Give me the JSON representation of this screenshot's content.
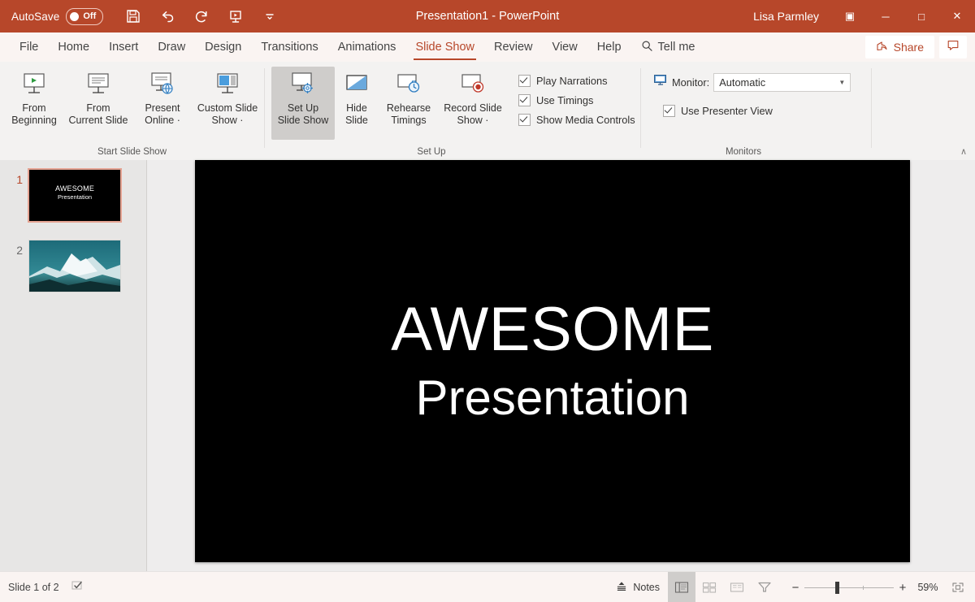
{
  "titlebar": {
    "autosave_label": "AutoSave",
    "autosave_state": "Off",
    "document_title": "Presentation1  -  PowerPoint",
    "user_name": "Lisa Parmley",
    "quick_access": [
      {
        "name": "save-icon",
        "tooltip": "Save"
      },
      {
        "name": "undo-icon",
        "tooltip": "Undo"
      },
      {
        "name": "redo-icon",
        "tooltip": "Redo"
      },
      {
        "name": "start-from-beginning-icon",
        "tooltip": "Start From Beginning"
      },
      {
        "name": "customize-quick-access-toolbar-icon",
        "tooltip": "Customize Quick Access Toolbar"
      }
    ],
    "window_controls": {
      "ribbon_display_options": "▣",
      "minimize": "─",
      "maximize": "□",
      "close": "✕"
    },
    "accent_color": "#b7472a"
  },
  "tabs": [
    {
      "label": "File",
      "active": false
    },
    {
      "label": "Home",
      "active": false
    },
    {
      "label": "Insert",
      "active": false
    },
    {
      "label": "Draw",
      "active": false
    },
    {
      "label": "Design",
      "active": false
    },
    {
      "label": "Transitions",
      "active": false
    },
    {
      "label": "Animations",
      "active": false
    },
    {
      "label": "Slide Show",
      "active": true
    },
    {
      "label": "Review",
      "active": false
    },
    {
      "label": "View",
      "active": false
    },
    {
      "label": "Help",
      "active": false
    }
  ],
  "tellme": {
    "label": "Tell me"
  },
  "share": {
    "label": "Share"
  },
  "ribbon": {
    "groups": [
      {
        "caption": "Start Slide Show",
        "buttons": [
          {
            "line1": "From",
            "line2": "Beginning",
            "icon": "from-beginning-icon",
            "selected": false,
            "dropdown": false
          },
          {
            "line1": "From",
            "line2": "Current Slide",
            "icon": "from-current-slide-icon",
            "selected": false,
            "dropdown": false
          },
          {
            "line1": "Present",
            "line2": "Online",
            "icon": "present-online-icon",
            "selected": false,
            "dropdown": true
          },
          {
            "line1": "Custom Slide",
            "line2": "Show",
            "icon": "custom-slide-show-icon",
            "selected": false,
            "dropdown": true
          }
        ]
      },
      {
        "caption": "Set Up",
        "buttons": [
          {
            "line1": "Set Up",
            "line2": "Slide Show",
            "icon": "set-up-slide-show-icon",
            "selected": true,
            "dropdown": false
          },
          {
            "line1": "Hide",
            "line2": "Slide",
            "icon": "hide-slide-icon",
            "selected": false,
            "dropdown": false
          },
          {
            "line1": "Rehearse",
            "line2": "Timings",
            "icon": "rehearse-timings-icon",
            "selected": false,
            "dropdown": false
          },
          {
            "line1": "Record Slide",
            "line2": "Show",
            "icon": "record-slide-show-icon",
            "selected": false,
            "dropdown": true
          }
        ],
        "checkboxes": [
          {
            "label": "Play Narrations",
            "checked": true
          },
          {
            "label": "Use Timings",
            "checked": true
          },
          {
            "label": "Show Media Controls",
            "checked": true
          }
        ]
      },
      {
        "caption": "Monitors",
        "monitor_label": "Monitor:",
        "monitor_value": "Automatic",
        "monitor_options": [
          "Automatic"
        ],
        "checkboxes": [
          {
            "label": "Use Presenter View",
            "checked": true
          }
        ]
      }
    ],
    "collapse_arrow": "∧"
  },
  "thumbnails": [
    {
      "number": "1",
      "selected": true,
      "type": "title",
      "title": "AWESOME",
      "subtitle": "Presentation"
    },
    {
      "number": "2",
      "selected": false,
      "type": "image",
      "alt": "mountain-photo"
    }
  ],
  "slide": {
    "title": "AWESOME",
    "subtitle": "Presentation",
    "background": "#000000",
    "text_color": "#ffffff"
  },
  "statusbar": {
    "slide_counter": "Slide 1 of 2",
    "spellcheck_icon": "accessibility-check-icon",
    "notes_label": "Notes",
    "views": [
      {
        "name": "normal-view-button",
        "active": true
      },
      {
        "name": "slide-sorter-view-button",
        "active": false
      },
      {
        "name": "reading-view-button",
        "active": false
      },
      {
        "name": "slide-show-view-button",
        "active": false
      }
    ],
    "zoom_out": "−",
    "zoom_in": "+",
    "zoom_level": "59%",
    "fit_to_window": "fit-slide-to-window-icon"
  }
}
